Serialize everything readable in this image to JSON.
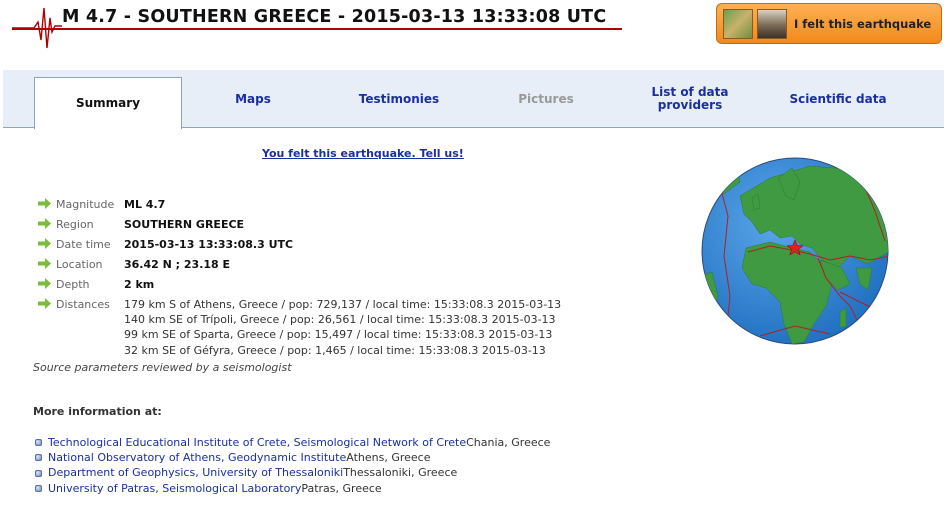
{
  "header": {
    "title": "M 4.7 - SOUTHERN GREECE - 2015-03-13 13:33:08 UTC",
    "felt_button_label": "I felt this earthquake"
  },
  "tabs": [
    {
      "label": "Summary",
      "state": "active"
    },
    {
      "label": "Maps",
      "state": "normal"
    },
    {
      "label": "Testimonies",
      "state": "normal"
    },
    {
      "label": "Pictures",
      "state": "disabled"
    },
    {
      "label": "List of data providers",
      "state": "normal"
    },
    {
      "label": "Scientific data",
      "state": "normal"
    }
  ],
  "felt_link": "You felt this earthquake. Tell us!",
  "info": {
    "magnitude": {
      "key": "Magnitude",
      "value": "ML 4.7"
    },
    "region": {
      "key": "Region",
      "value": "SOUTHERN GREECE"
    },
    "date_time": {
      "key": "Date time",
      "value": "2015-03-13 13:33:08.3 UTC"
    },
    "location": {
      "key": "Location",
      "value": "36.42 N ; 23.18 E"
    },
    "depth": {
      "key": "Depth",
      "value": "2 km"
    },
    "distances": {
      "key": "Distances",
      "lines": [
        "179 km S of Athens, Greece / pop: 729,137 / local time: 15:33:08.3 2015-03-13",
        "140 km SE of Trípoli, Greece / pop: 26,561 / local time: 15:33:08.3 2015-03-13",
        "99 km SE of Sparta, Greece / pop: 15,497 / local time: 15:33:08.3 2015-03-13",
        "32 km SE of Géfyra, Greece / pop: 1,465 / local time: 15:33:08.3 2015-03-13"
      ]
    }
  },
  "reviewed_note": "Source parameters reviewed by a seismologist",
  "more_info": {
    "heading": "More information at:",
    "items": [
      {
        "link": "Technological Educational Institute of Crete, Seismological Network of Crete",
        "place": " Chania, Greece"
      },
      {
        "link": "National Observatory of Athens, Geodynamic Institute",
        "place": " Athens, Greece"
      },
      {
        "link": "Department of Geophysics, University of Thessaloniki",
        "place": " Thessaloniki, Greece"
      },
      {
        "link": "University of Patras, Seismological Laboratory",
        "place": " Patras, Greece"
      }
    ]
  },
  "colors": {
    "link": "#1a2fa0",
    "tab_bar": "#e7eef8",
    "title_rule": "#b00000",
    "button_orange": "#f08a1c",
    "ocean": "#2f7fd0",
    "land": "#3f9a42",
    "plates": "#b02020",
    "epicenter": "#e02020"
  },
  "icons": {
    "logo": "seismogram-icon",
    "row_marker": "green-arrow-icon",
    "link_marker": "bullet-icon"
  }
}
